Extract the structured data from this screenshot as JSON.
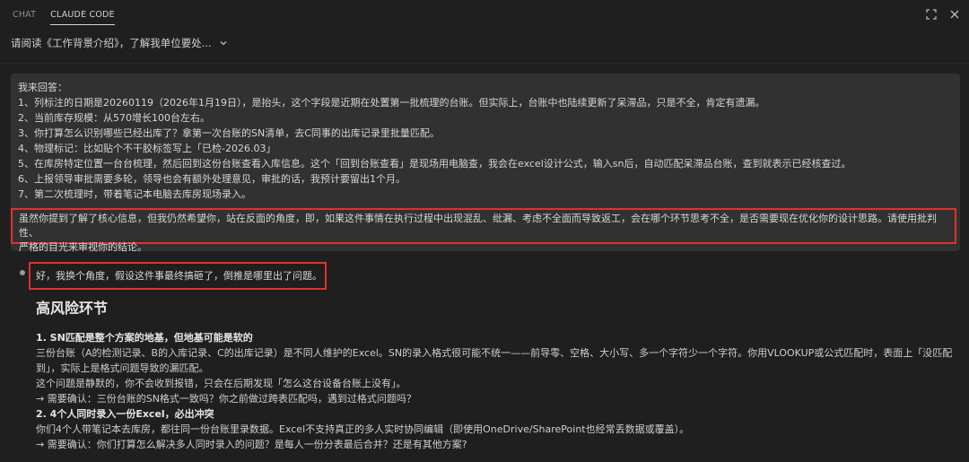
{
  "tabs": [
    {
      "label": "CHAT",
      "active": false
    },
    {
      "label": "CLAUDE CODE",
      "active": true
    }
  ],
  "session": {
    "title": "请阅读《工作背景介绍》，了解我单位要处..."
  },
  "user_message": {
    "lines": [
      "我来回答：",
      "1、列标注的日期是20260119（2026年1月19日），是抬头，这个字段是近期在处置第一批梳理的台账。但实际上，台账中也陆续更新了呆滞品，只是不全，肯定有遗漏。",
      "2、当前库存规模：从570增长100台左右。",
      "3、你打算怎么识别哪些已经出库了？拿第一次台账的SN清单，去C同事的出库记录里批量匹配。",
      "4、物理标记：比如贴个不干胶标签写上「已检-2026.03」",
      "5、在库房特定位置一台台梳理，然后回到这份台账查看入库信息。这个「回到台账查看」是现场用电脑查，我会在excel设计公式，输入sn后，自动匹配呆滞品台账，查到就表示已经核查过。",
      "6、上报领导审批需要多轮，领导也会有额外处理意见，审批的话，我预计要留出1个月。",
      "7、第二次梳理时，带着笔记本电脑去库房现场录入。"
    ],
    "highlight_lines": [
      "虽然你提到了解了核心信息，但我仍然希望你，站在反面的角度，即，如果这件事情在执行过程中出现混乱、纰漏、考虑不全面而导致返工，会在哪个环节思考不全，是否需要现在优化你的设计思路。请使用批判性、",
      "严格的目光来审视你的结论。"
    ]
  },
  "assistant": {
    "intro": "好，我换个角度，假设这件事最终搞砸了，倒推是哪里出了问题。",
    "heading": "高风险环节",
    "sections": [
      {
        "title": "1. SN匹配是整个方案的地基，但地基可能是软的",
        "lines": [
          "三份台账（A的检测记录、B的入库记录、C的出库记录）是不同人维护的Excel。SN的录入格式很可能不统一——前导零、空格、大小写、多一个字符少一个字符。你用VLOOKUP或公式匹配时，表面上「没匹配",
          "到」，实际上是格式问题导致的漏匹配。",
          "这个问题是静默的，你不会收到报错，只会在后期发现「怎么这台设备台账上没有」。",
          "→ 需要确认：三份台账的SN格式一致吗？你之前做过跨表匹配吗，遇到过格式问题吗？"
        ]
      },
      {
        "title": "2. 4个人同时录入一份Excel，必出冲突",
        "lines": [
          "你们4个人带笔记本去库房，都往同一份台账里录数据。Excel不支持真正的多人实时协同编辑（即使用OneDrive/SharePoint也经常丢数据或覆盖）。",
          "→ 需要确认：你们打算怎么解决多人同时录入的问题？是每人一份分表最后合并？还是有其他方案?"
        ]
      }
    ]
  }
}
